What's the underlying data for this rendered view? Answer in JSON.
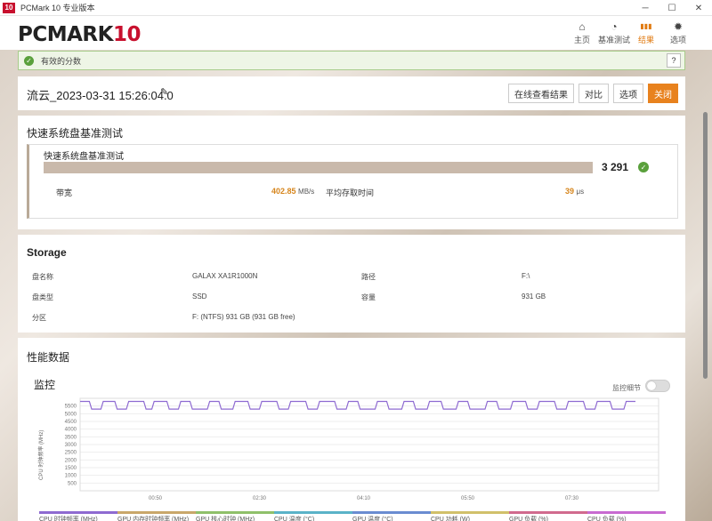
{
  "window": {
    "title": "PCMark 10 专业版本",
    "icon_text": "10"
  },
  "header": {
    "logo_main": "PCMARK",
    "logo_num": "10",
    "nav": [
      {
        "label": "主页",
        "icon": "home-icon",
        "glyph": "⌂"
      },
      {
        "label": "基准测试",
        "icon": "gauge-icon",
        "glyph": "◔"
      },
      {
        "label": "结果",
        "icon": "bar-chart-icon",
        "glyph": "▮▮▮"
      },
      {
        "label": "选项",
        "icon": "gear-icon",
        "glyph": "✹"
      }
    ]
  },
  "notice": {
    "text": "有效的分数",
    "help": "?"
  },
  "result": {
    "title": "流云_2023-03-31 15:26:04.0",
    "buttons": {
      "online": "在线查看结果",
      "compare": "对比",
      "options": "选项",
      "close": "关闭"
    }
  },
  "test_panel": {
    "title": "快速系统盘基准测试",
    "test_name": "快速系统盘基准测试",
    "score": "3 291",
    "bandwidth_label": "带宽",
    "bandwidth_value": "402.85",
    "bandwidth_unit": "MB/s",
    "access_label": "平均存取时间",
    "access_value": "39",
    "access_unit": "μs"
  },
  "storage": {
    "title": "Storage",
    "drive_name_label": "盘名称",
    "drive_name": "GALAX XA1R1000N",
    "path_label": "路径",
    "path": "F:\\",
    "drive_type_label": "盘类型",
    "drive_type": "SSD",
    "capacity_label": "容量",
    "capacity": "931 GB",
    "partition_label": "分区",
    "partition": "F: (NTFS) 931 GB (931 GB free)"
  },
  "perf": {
    "title": "性能数据",
    "monitor_title": "监控",
    "toggle_label": "监控细节",
    "legend": [
      "CPU 时钟频率 (MHz)",
      "GPU 内存时钟频率 (MHz)",
      "GPU 核心时钟 (MHz)",
      "CPU 温度 (°C)",
      "GPU 温度 (°C)",
      "CPU 功耗 (W)",
      "GPU 负载 (%)",
      "CPU 负载 (%)"
    ],
    "legend_colors": [
      "#8e6ad1",
      "#c9a76a",
      "#8fc06a",
      "#5ab3c8",
      "#6a8cd1",
      "#d1c06a",
      "#d16a8e",
      "#c86ad1"
    ]
  },
  "chart_data": {
    "type": "line",
    "ylabel": "CPU 时钟频率 (MHz)",
    "yticks": [
      500,
      1000,
      1500,
      2000,
      2500,
      3000,
      3500,
      4000,
      4500,
      5000,
      5500
    ],
    "ylim": [
      0,
      6000
    ],
    "xticks": [
      "00:50",
      "02:30",
      "04:10",
      "05:50",
      "07:30"
    ],
    "xlim": [
      0,
      500
    ],
    "series": [
      {
        "color": "#8e6ad1",
        "x": [
          0,
          8,
          10,
          18,
          20,
          30,
          32,
          40,
          42,
          55,
          57,
          62,
          64,
          75,
          77,
          85,
          87,
          95,
          97,
          110,
          112,
          120,
          122,
          132,
          134,
          145,
          147,
          155,
          157,
          170,
          172,
          180,
          182,
          195,
          197,
          205,
          207,
          220,
          222,
          230,
          232,
          240,
          242,
          255,
          257,
          265,
          267,
          278,
          280,
          288,
          290,
          300,
          302,
          312,
          314,
          325,
          327,
          335,
          337,
          350,
          352,
          360,
          362,
          372,
          374,
          385,
          387,
          395,
          397,
          410,
          412,
          420,
          422,
          435,
          437,
          445,
          447,
          458,
          460,
          470,
          472,
          480
        ],
        "y": [
          5800,
          5800,
          5300,
          5300,
          5800,
          5800,
          5300,
          5300,
          5800,
          5800,
          5300,
          5300,
          5800,
          5800,
          5300,
          5300,
          5800,
          5800,
          5300,
          5300,
          5800,
          5800,
          5300,
          5300,
          5800,
          5800,
          5300,
          5300,
          5800,
          5800,
          5300,
          5300,
          5800,
          5800,
          5300,
          5300,
          5800,
          5800,
          5300,
          5300,
          5800,
          5800,
          5300,
          5300,
          5800,
          5800,
          5300,
          5300,
          5800,
          5800,
          5300,
          5300,
          5800,
          5800,
          5300,
          5300,
          5800,
          5800,
          5300,
          5300,
          5800,
          5800,
          5300,
          5300,
          5800,
          5800,
          5300,
          5300,
          5800,
          5800,
          5300,
          5300,
          5800,
          5800,
          5300,
          5300,
          5800,
          5800,
          5300,
          5300,
          5800,
          5800
        ]
      }
    ]
  }
}
